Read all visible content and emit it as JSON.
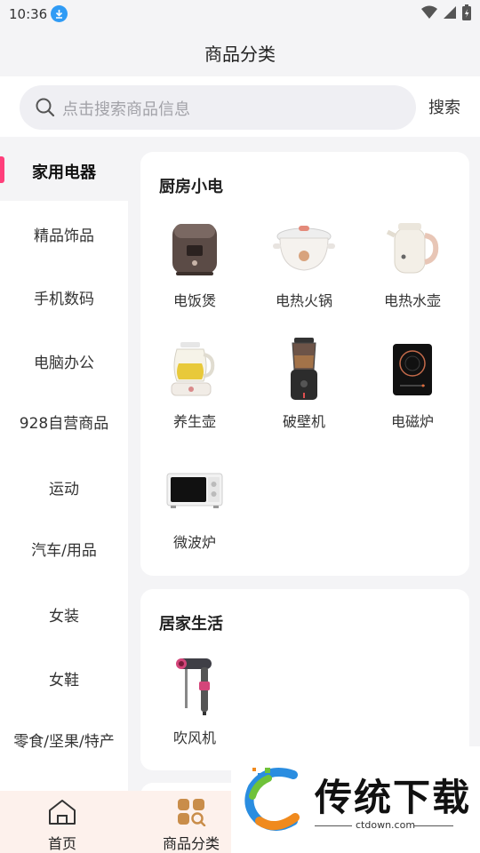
{
  "status": {
    "time": "10:36"
  },
  "header": {
    "title": "商品分类"
  },
  "search": {
    "placeholder": "点击搜索商品信息",
    "button": "搜索"
  },
  "sidebar": {
    "items": [
      {
        "label": "家用电器",
        "active": true
      },
      {
        "label": "精品饰品"
      },
      {
        "label": "手机数码"
      },
      {
        "label": "电脑办公"
      },
      {
        "label": "928自营商品"
      },
      {
        "label": "运动"
      },
      {
        "label": "汽车/用品"
      },
      {
        "label": "女装"
      },
      {
        "label": "女鞋"
      },
      {
        "label": "零食/坚果/特产"
      }
    ]
  },
  "sections": [
    {
      "title": "厨房小电",
      "products": [
        {
          "name": "电饭煲",
          "icon": "rice-cooker"
        },
        {
          "name": "电热火锅",
          "icon": "hot-pot"
        },
        {
          "name": "电热水壶",
          "icon": "kettle"
        },
        {
          "name": "养生壶",
          "icon": "health-pot"
        },
        {
          "name": "破壁机",
          "icon": "blender"
        },
        {
          "name": "电磁炉",
          "icon": "induction-cooker"
        },
        {
          "name": "微波炉",
          "icon": "microwave"
        }
      ]
    },
    {
      "title": "居家生活",
      "products": [
        {
          "name": "吹风机",
          "icon": "hair-dryer"
        }
      ]
    }
  ],
  "tabbar": {
    "items": [
      {
        "label": "首页",
        "icon": "home-icon"
      },
      {
        "label": "商品分类",
        "icon": "category-icon"
      }
    ]
  },
  "watermark": {
    "text": "传统下载",
    "url": "ctdown.com"
  }
}
